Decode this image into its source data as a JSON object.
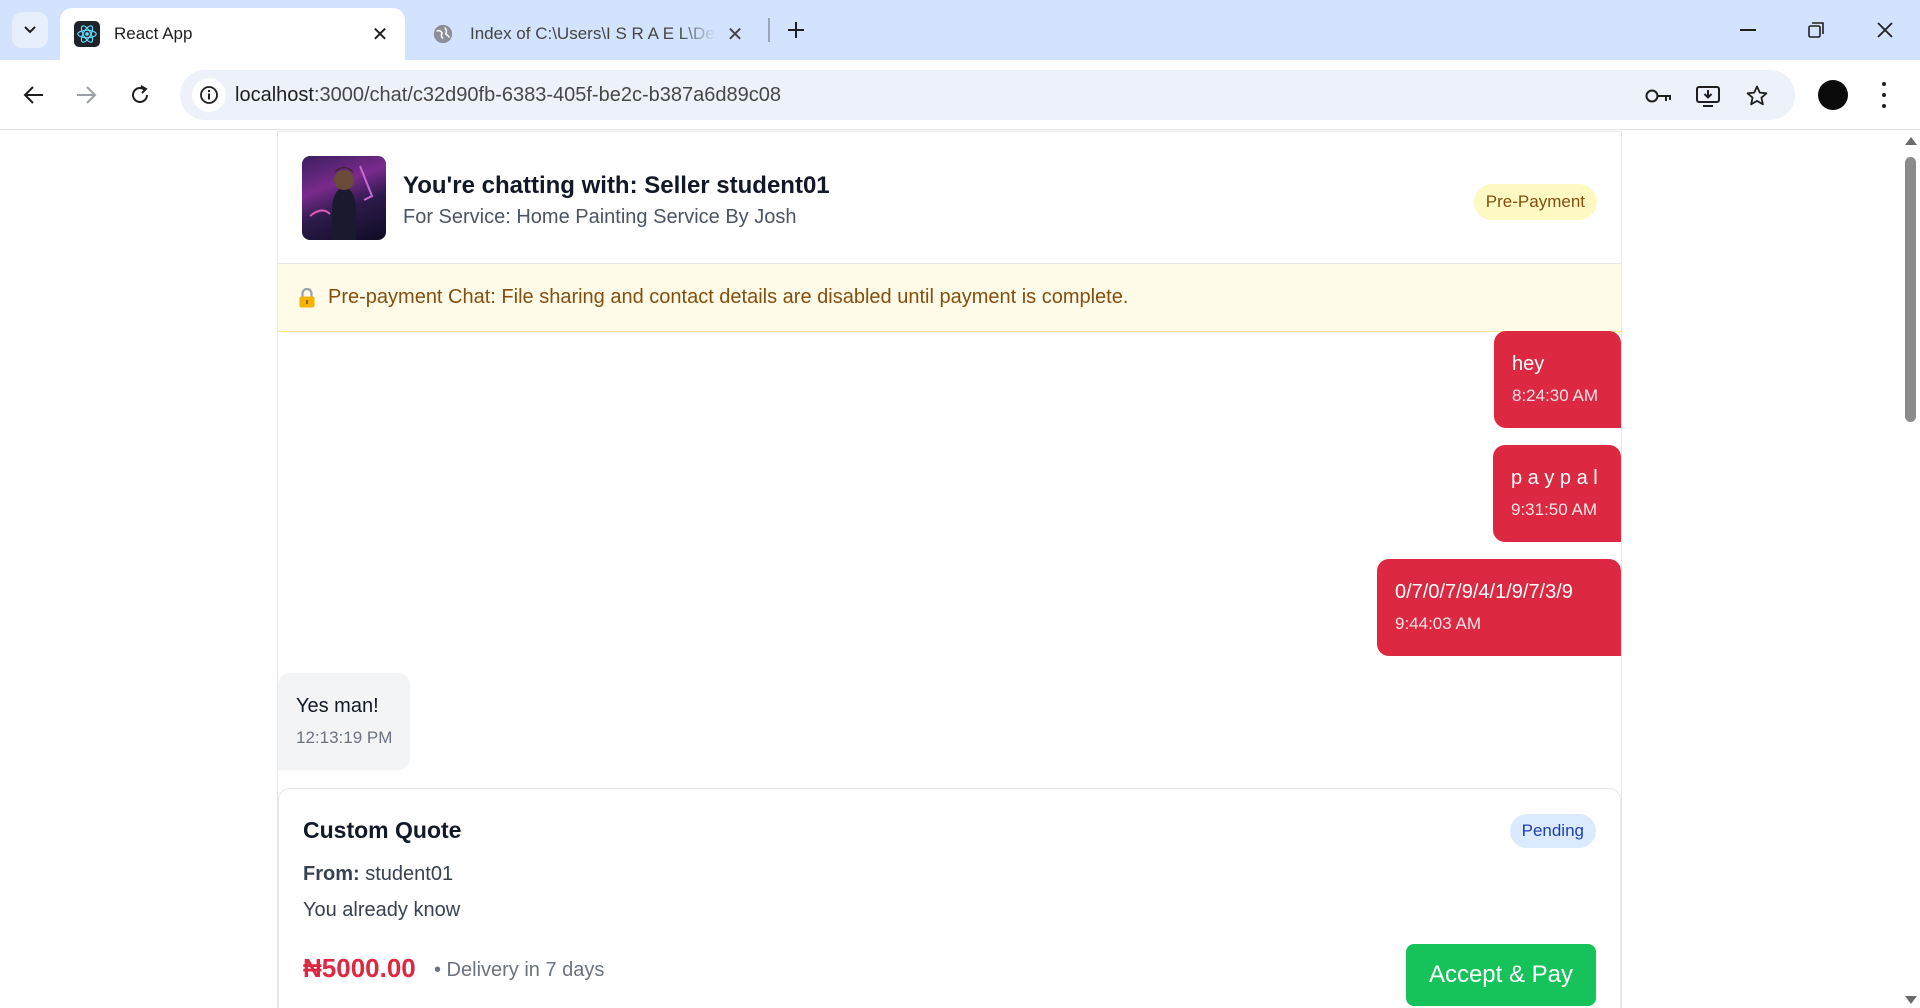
{
  "browser": {
    "tabs": [
      {
        "title": "React App",
        "active": true,
        "icon": "react-icon"
      },
      {
        "title": "Index of C:\\Users\\I S R A E L\\Desktop",
        "active": false,
        "icon": "globe-icon"
      }
    ],
    "url_host": "localhost",
    "url_rest": ":3000/chat/c32d90fb-6383-405f-be2c-b387a6d89c08"
  },
  "chat": {
    "header": {
      "title": "You're chatting with: Seller student01",
      "subtitle": "For Service: Home Painting Service By Josh",
      "status": "Pre-Payment"
    },
    "notice": "Pre-payment Chat: File sharing and contact details are disabled until payment is complete.",
    "messages": [
      {
        "direction": "sent",
        "text": "hey",
        "time": "8:24:30 AM"
      },
      {
        "direction": "sent",
        "text": "p a y p a l",
        "time": "9:31:50 AM"
      },
      {
        "direction": "sent",
        "text": "0/7/0/7/9/4/1/9/7/3/9",
        "time": "9:44:03 AM"
      },
      {
        "direction": "received",
        "text": "Yes man!",
        "time": "12:13:19 PM"
      }
    ],
    "quote": {
      "title": "Custom Quote",
      "status": "Pending",
      "from_label": "From:",
      "from_value": "student01",
      "description": "You already know",
      "price": "₦5000.00",
      "delivery": "• Delivery in 7 days",
      "accept_label": "Accept & Pay"
    }
  },
  "colors": {
    "sent_bubble": "#dc2841",
    "accept_button": "#16c35a",
    "notice_bg": "#fefce8",
    "tabbar_bg": "#d3e3fd"
  }
}
